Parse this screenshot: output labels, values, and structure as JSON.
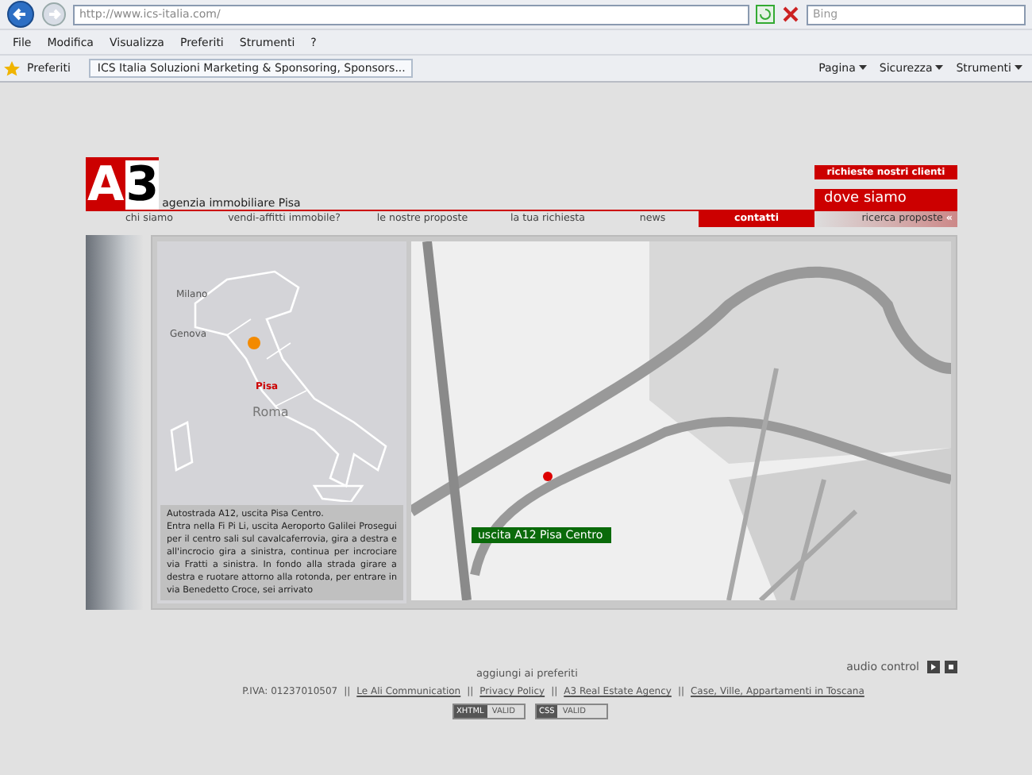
{
  "browser": {
    "url": "http://www.ics-italia.com/",
    "search_placeholder": "Bing",
    "menu": [
      "File",
      "Modifica",
      "Visualizza",
      "Preferiti",
      "Strumenti",
      "?"
    ],
    "favorites_label": "Preferiti",
    "tab_title": "ICS Italia Soluzioni Marketing & Sponsoring, Sponsors...",
    "toolbar": [
      "Pagina",
      "Sicurezza",
      "Strumenti"
    ]
  },
  "header": {
    "logo_letter": "A",
    "logo_digit": "3",
    "tagline": "agenzia immobiliare Pisa",
    "clients_button": "richieste nostri clienti",
    "where_button": "dove siamo"
  },
  "nav": [
    {
      "label": "chi siamo",
      "selected": false
    },
    {
      "label": "vendi-affitti immobile?",
      "selected": false
    },
    {
      "label": "le nostre proposte",
      "selected": false
    },
    {
      "label": "la tua richiesta",
      "selected": false
    },
    {
      "label": "news",
      "selected": false
    },
    {
      "label": "contatti",
      "selected": true
    }
  ],
  "search_tab": {
    "label": "ricerca proposte",
    "icon": "«"
  },
  "italy_map": {
    "cities": [
      {
        "name": "Milano",
        "kind": "city"
      },
      {
        "name": "Genova",
        "kind": "city"
      },
      {
        "name": "Pisa",
        "kind": "target"
      },
      {
        "name": "Roma",
        "kind": "capital"
      }
    ]
  },
  "directions": "Autostrada A12, uscita Pisa Centro.\nEntra nella Fi Pi Li, uscita Aeroporto Galilei Prosegui per il centro sali sul cavalcaferrovia, gira a destra e all'incrocio gira a sinistra, continua per incrociare via Fratti a sinistra. In fondo alla strada girare a destra e ruotare attorno alla rotonda, per entrare in via Benedetto Croce, sei arrivato",
  "route_label": "uscita A12 Pisa Centro",
  "footer": {
    "bookmark_link": "aggiungi ai preferiti",
    "audio_label": "audio control",
    "vat": "P.IVA: 01237010507",
    "links": [
      {
        "separator": "||",
        "text": "Le Ali Communication"
      },
      {
        "separator": "||",
        "text": "Privacy Policy"
      },
      {
        "separator": "||",
        "text": "A3 Real Estate Agency"
      },
      {
        "separator": "||",
        "text": "Case, Ville, Appartamenti in Toscana"
      }
    ],
    "badges": [
      {
        "tag": "XHTML",
        "text": "VALID"
      },
      {
        "tag": "CSS",
        "text": "VALID"
      }
    ]
  }
}
